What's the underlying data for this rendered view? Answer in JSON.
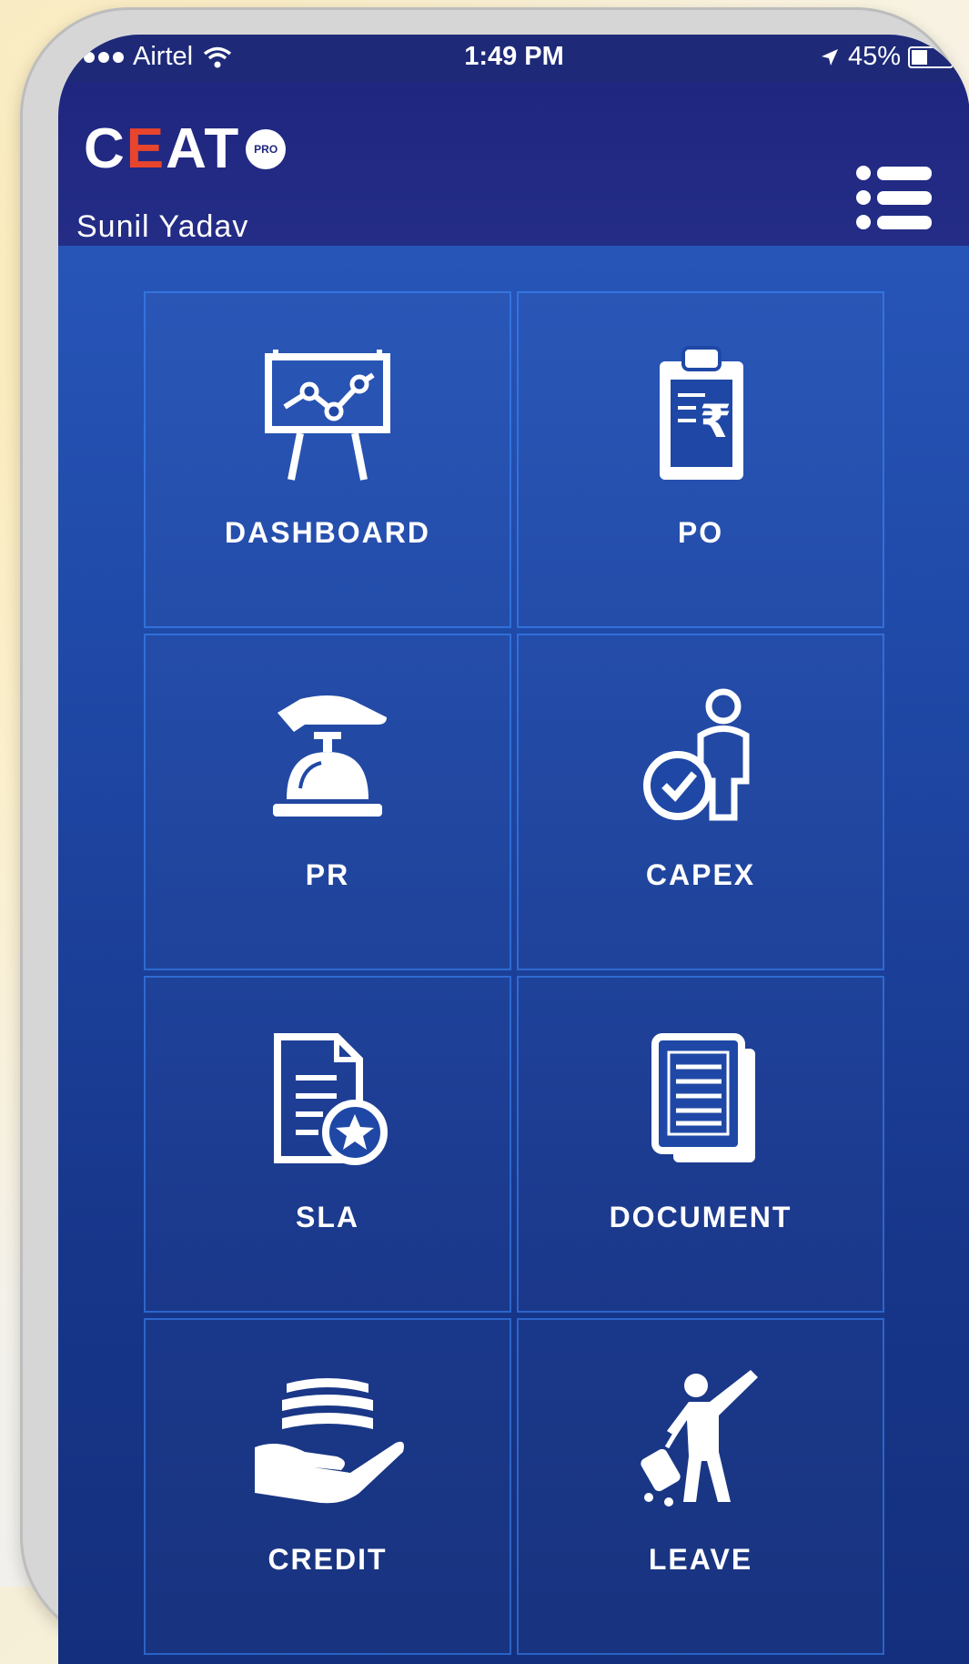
{
  "status_bar": {
    "carrier": "Airtel",
    "time": "1:49 PM",
    "battery": "45%",
    "battery_fraction": 0.45
  },
  "header": {
    "logo_text_1": "C",
    "logo_text_2": "E",
    "logo_text_3": "AT",
    "logo_badge": "PRO",
    "user_name": "Sunil Yadav"
  },
  "menu": {
    "items": [
      {
        "label": "DASHBOARD",
        "icon": "presentation-chart-icon"
      },
      {
        "label": "PO",
        "icon": "clipboard-rupee-icon"
      },
      {
        "label": "PR",
        "icon": "service-bell-icon"
      },
      {
        "label": "CAPEX",
        "icon": "person-check-icon"
      },
      {
        "label": "SLA",
        "icon": "document-star-icon"
      },
      {
        "label": "DOCUMENT",
        "icon": "documents-icon"
      },
      {
        "label": "CREDIT",
        "icon": "hand-money-icon"
      },
      {
        "label": "LEAVE",
        "icon": "traveler-icon"
      }
    ]
  },
  "colors": {
    "header": "#1f2680",
    "grid_bg": "#1f48a6",
    "logo_accent": "#e8452c"
  }
}
